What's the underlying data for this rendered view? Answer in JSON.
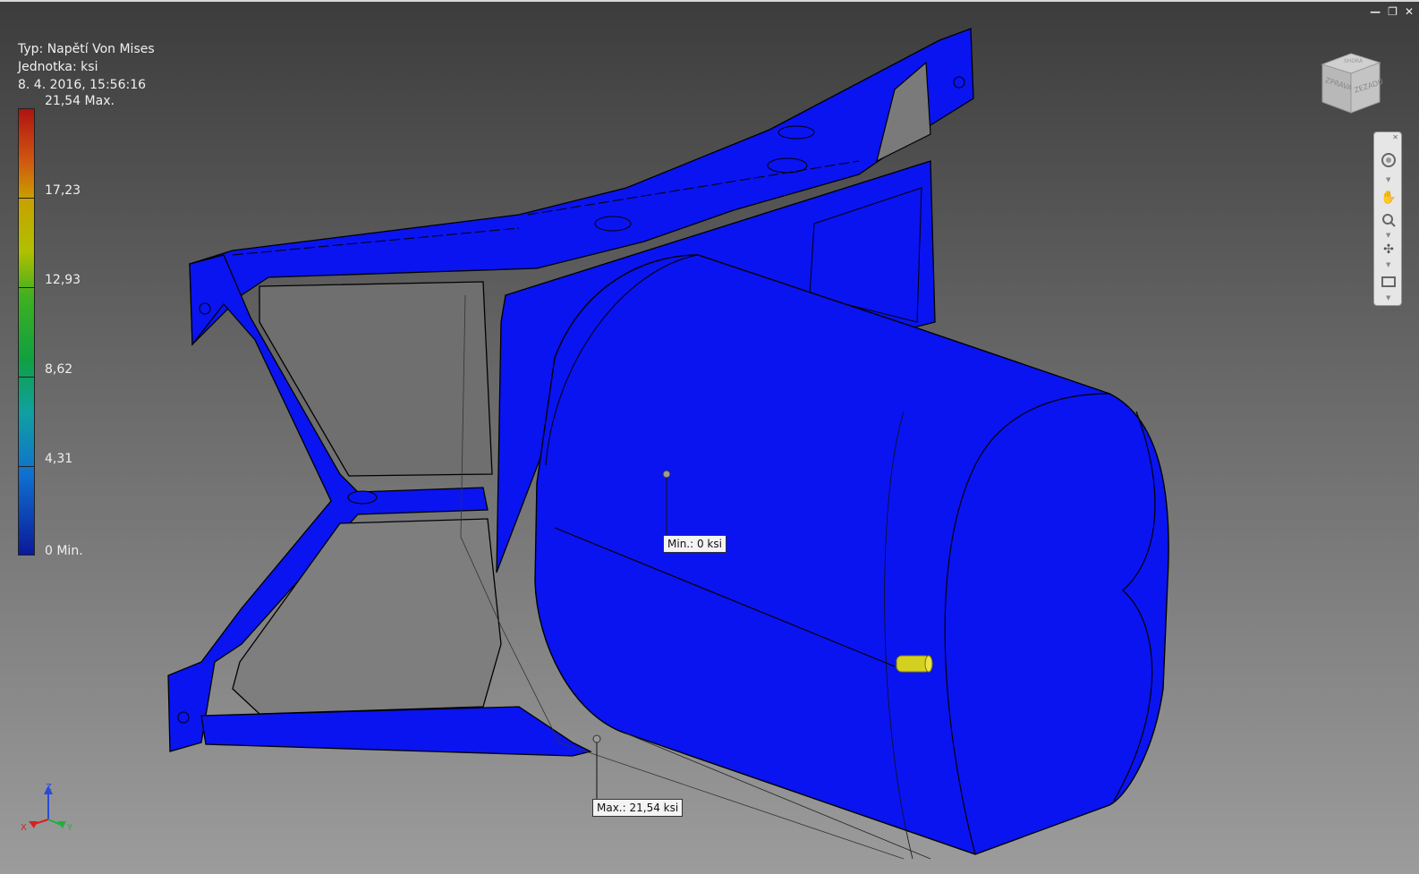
{
  "window": {
    "minimize_icon": "minimize-icon",
    "restore_icon": "restore-icon",
    "close_icon": "close-icon"
  },
  "result_info": {
    "type_line": "Typ: Napětí Von Mises",
    "unit_line": "Jednotka: ksi",
    "timestamp": "8. 4. 2016, 15:56:16"
  },
  "legend": {
    "labels": [
      "21,54 Max.",
      "17,23",
      "12,93",
      "8,62",
      "4,31",
      "0 Min."
    ],
    "colors": [
      "#b01212",
      "#c8a000",
      "#40b020",
      "#10a0a0",
      "#1070d0",
      "#0a1a9a"
    ]
  },
  "probes": {
    "min_label": "Min.: 0 ksi",
    "max_label": "Max.: 21,54 ksi"
  },
  "viewcube": {
    "faces": [
      "ZPRAVA",
      "ZEZADU",
      "SHORA"
    ]
  },
  "navigation_bar": {
    "buttons": [
      "steering-wheel-icon",
      "pan-icon",
      "zoom-icon",
      "orbit-icon",
      "look-at-icon"
    ]
  },
  "triad": {
    "x": "X",
    "y": "Y",
    "z": "Z"
  },
  "colors": {
    "model": "#0a14f0",
    "highlight": "#d4d020"
  }
}
